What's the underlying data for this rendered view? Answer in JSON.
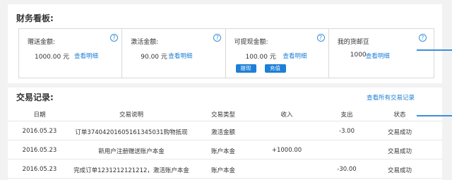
{
  "dashboard": {
    "title": "财务看板:",
    "cards": [
      {
        "label": "赠送金额:",
        "amount": "1000.00 元",
        "link": "查看明细"
      },
      {
        "label": "激活金额:",
        "amount": "90.00 元",
        "link": "查看明细"
      },
      {
        "label": "可提现金额:",
        "amount": "100.00 元",
        "link": "查看明细",
        "buttons": [
          "提现",
          "充值"
        ]
      },
      {
        "label": "我的货邮豆",
        "amount": "1000",
        "link": "查看明细"
      }
    ],
    "help_icon": "?"
  },
  "transactions": {
    "title": "交易记录:",
    "view_all": "查看所有交易记录",
    "columns": [
      "日期",
      "交易说明",
      "交易类型",
      "收入",
      "支出",
      "状态"
    ],
    "rows": [
      {
        "date": "2016.05.23",
        "desc": "订单37404201605161345031购物抵现",
        "type": "激活金额",
        "income": "",
        "expense": "-3.00",
        "status": "交易成功"
      },
      {
        "date": "2016.05.23",
        "desc": "新用户注册赠送账户本金",
        "type": "账户本金",
        "income": "+1000.00",
        "expense": "",
        "status": "交易成功"
      },
      {
        "date": "2016.05.23",
        "desc": "完成订单1231212121212，激活账户本金",
        "type": "账户本金",
        "income": "",
        "expense": "-30.00",
        "status": "交易成功"
      }
    ]
  },
  "colors": {
    "accent": "#1e7fd6",
    "background": "#f2f2f2",
    "marker": "#3b8fd9"
  }
}
